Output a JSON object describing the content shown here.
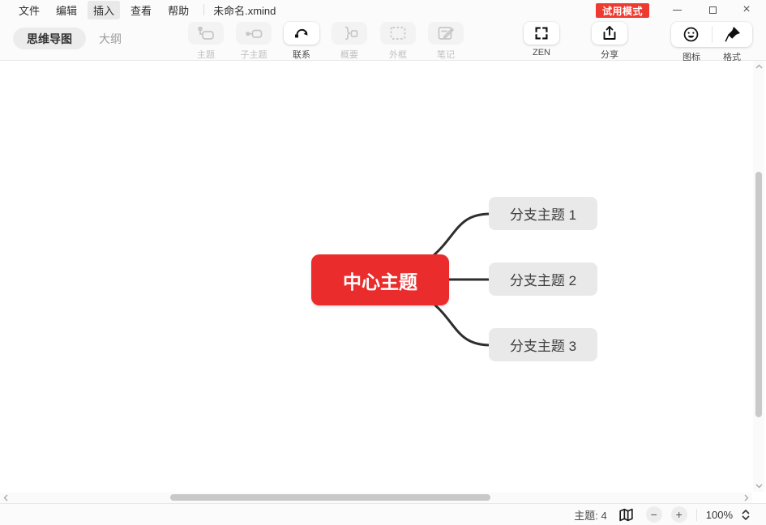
{
  "menu_bar": {
    "items": [
      "文件",
      "编辑",
      "插入",
      "查看",
      "帮助"
    ],
    "highlighted_item": "插入",
    "filename": "未命名.xmind",
    "trial_badge": "试用模式"
  },
  "window_controls": {
    "close_glyph": "×"
  },
  "toolbar": {
    "view_tabs": [
      {
        "label": "思维导图",
        "active": true
      },
      {
        "label": "大纲",
        "active": false
      }
    ],
    "tools": [
      {
        "label": "主题",
        "icon": "topic-icon",
        "enabled": false
      },
      {
        "label": "子主题",
        "icon": "subtopic-icon",
        "enabled": false
      },
      {
        "label": "联系",
        "icon": "relationship-icon",
        "enabled": true
      },
      {
        "label": "概要",
        "icon": "summary-icon",
        "enabled": false
      },
      {
        "label": "外框",
        "icon": "boundary-icon",
        "enabled": false
      },
      {
        "label": "笔记",
        "icon": "note-icon",
        "enabled": false
      },
      {
        "label": "ZEN",
        "icon": "zen-icon",
        "enabled": true
      },
      {
        "label": "分享",
        "icon": "share-icon",
        "enabled": true
      }
    ],
    "right_tools": [
      {
        "label": "图标",
        "icon": "marker-smiley-icon"
      },
      {
        "label": "格式",
        "icon": "format-brush-icon"
      }
    ]
  },
  "mindmap": {
    "central_topic": "中心主题",
    "branches": [
      "分支主题 1",
      "分支主题 2",
      "分支主题 3"
    ],
    "colors": {
      "central_bg": "#EA2C2C",
      "central_text": "#FFFFFF",
      "branch_bg": "#E9E9E9",
      "branch_text": "#3D3D3D",
      "connector": "#2E2E2E",
      "trial_badge_bg": "#EE3B30"
    }
  },
  "status_bar": {
    "topic_count": "主题: 4",
    "minus_glyph": "−",
    "plus_glyph": "+",
    "zoom_level": "100%"
  }
}
